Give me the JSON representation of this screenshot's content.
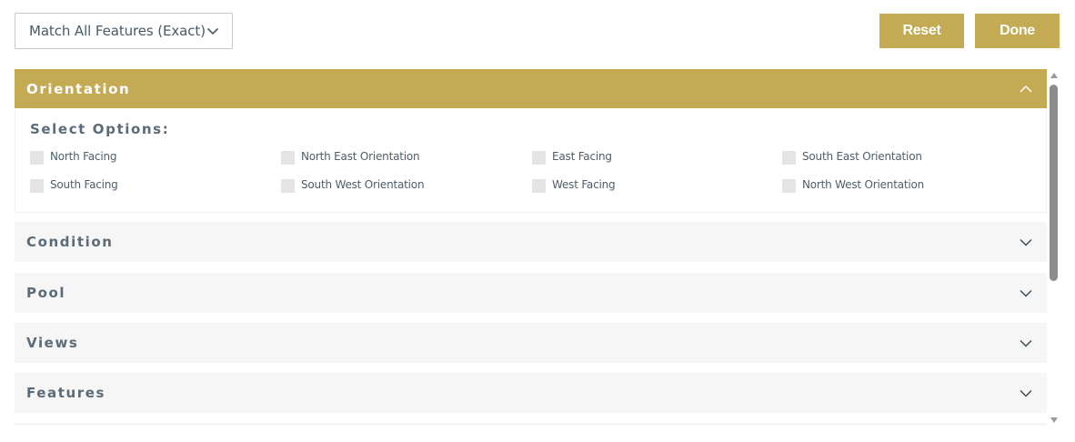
{
  "match_select": {
    "value": "Match All Features (Exact)"
  },
  "buttons": {
    "reset": "Reset",
    "done": "Done"
  },
  "accordion": {
    "orientation": {
      "title": "Orientation",
      "select_label": "Select Options:",
      "options": [
        "North Facing",
        "North East Orientation",
        "East Facing",
        "South East Orientation",
        "South Facing",
        "South West Orientation",
        "West Facing",
        "North West Orientation"
      ]
    },
    "condition": {
      "title": "Condition"
    },
    "pool": {
      "title": "Pool"
    },
    "views": {
      "title": "Views"
    },
    "features": {
      "title": "Features"
    }
  },
  "colors": {
    "accent": "#c3aa53",
    "section_bg": "#f6f6f6",
    "text": "#5b6b78",
    "checkbox": "#e4e4e4"
  },
  "icons": {
    "dropdown": "chevron-down-icon",
    "expanded": "chevron-up-icon",
    "collapsed": "chevron-down-icon"
  }
}
